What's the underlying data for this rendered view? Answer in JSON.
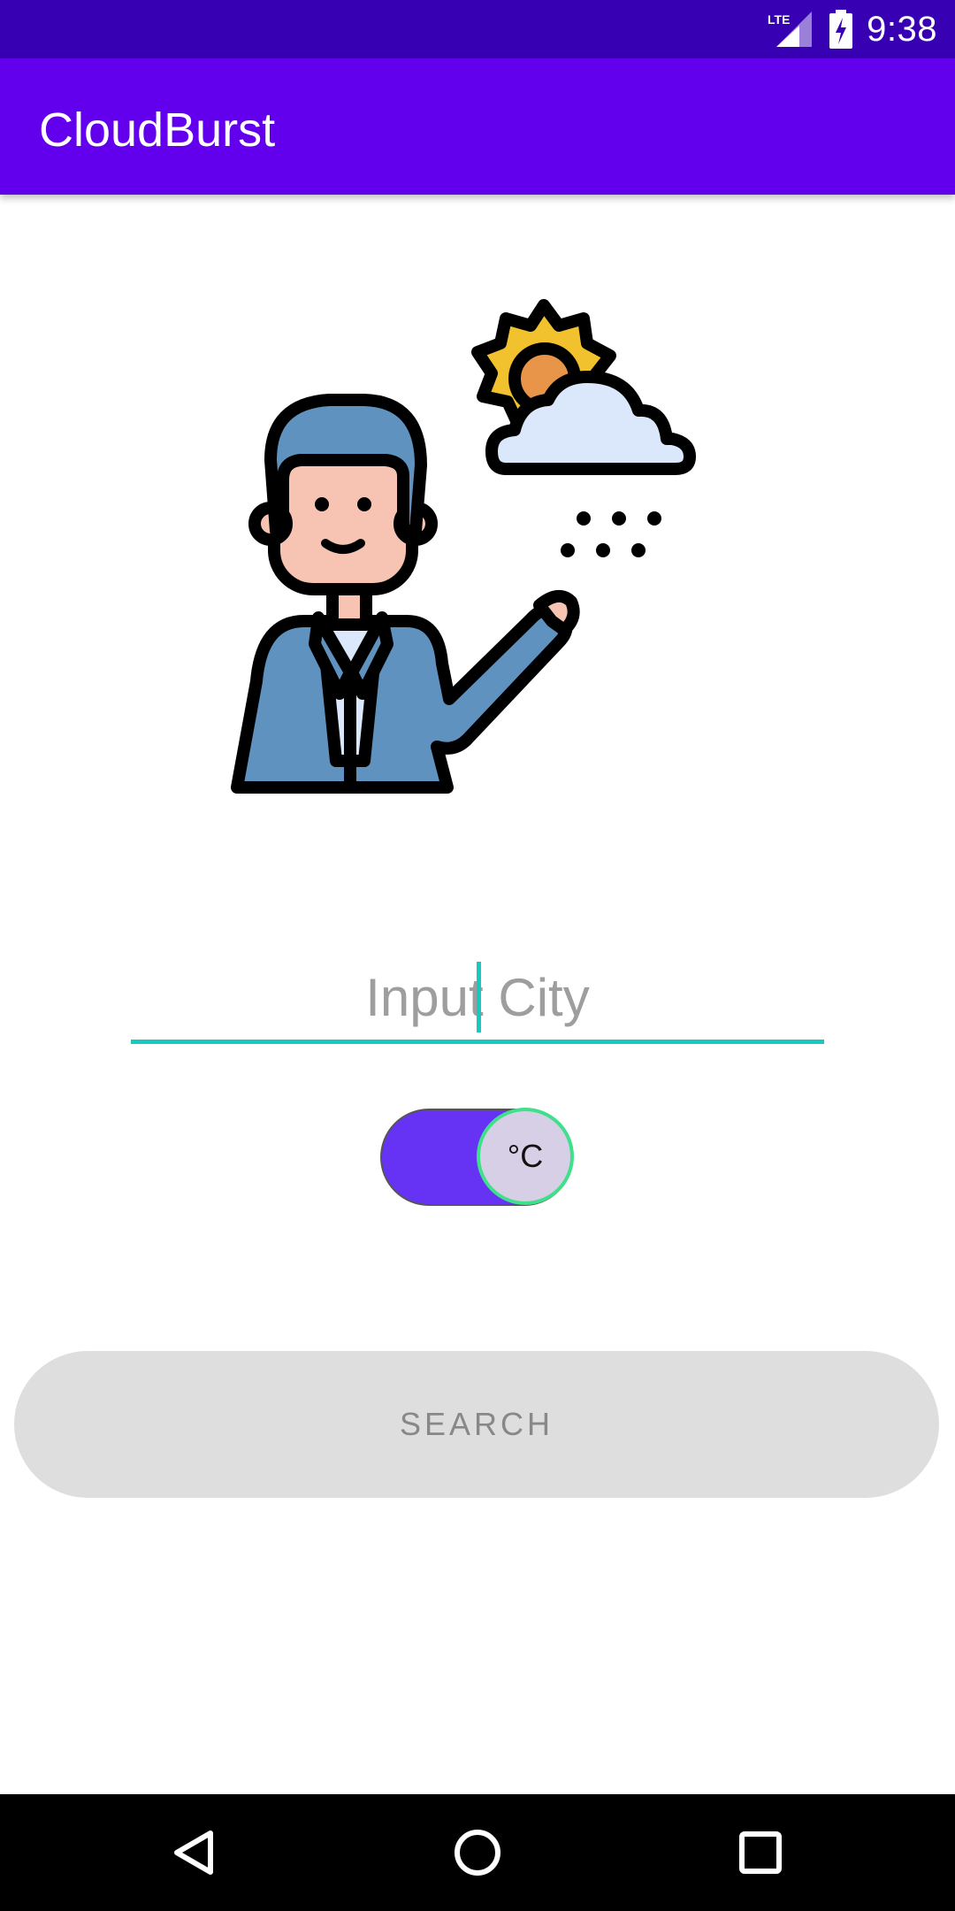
{
  "status_bar": {
    "network_label": "LTE",
    "time": "9:38",
    "icons": [
      "lte-signal-icon",
      "battery-charging-icon"
    ]
  },
  "app_bar": {
    "title": "CloudBurst"
  },
  "illustration": {
    "icon": "weather-presenter-illustration"
  },
  "city_input": {
    "placeholder": "Input City",
    "value": ""
  },
  "unit_toggle": {
    "label": "°C",
    "checked": true
  },
  "search_button": {
    "label": "SEARCH"
  },
  "nav_bar": {
    "icons": [
      "back-icon",
      "home-icon",
      "recents-icon"
    ]
  },
  "colors": {
    "status_bar": "#3700b3",
    "app_bar": "#6200ee",
    "accent": "#18c9c0",
    "toggle_track": "#6633f5",
    "toggle_thumb": "#d6cfe6",
    "button_bg": "#dedede"
  }
}
